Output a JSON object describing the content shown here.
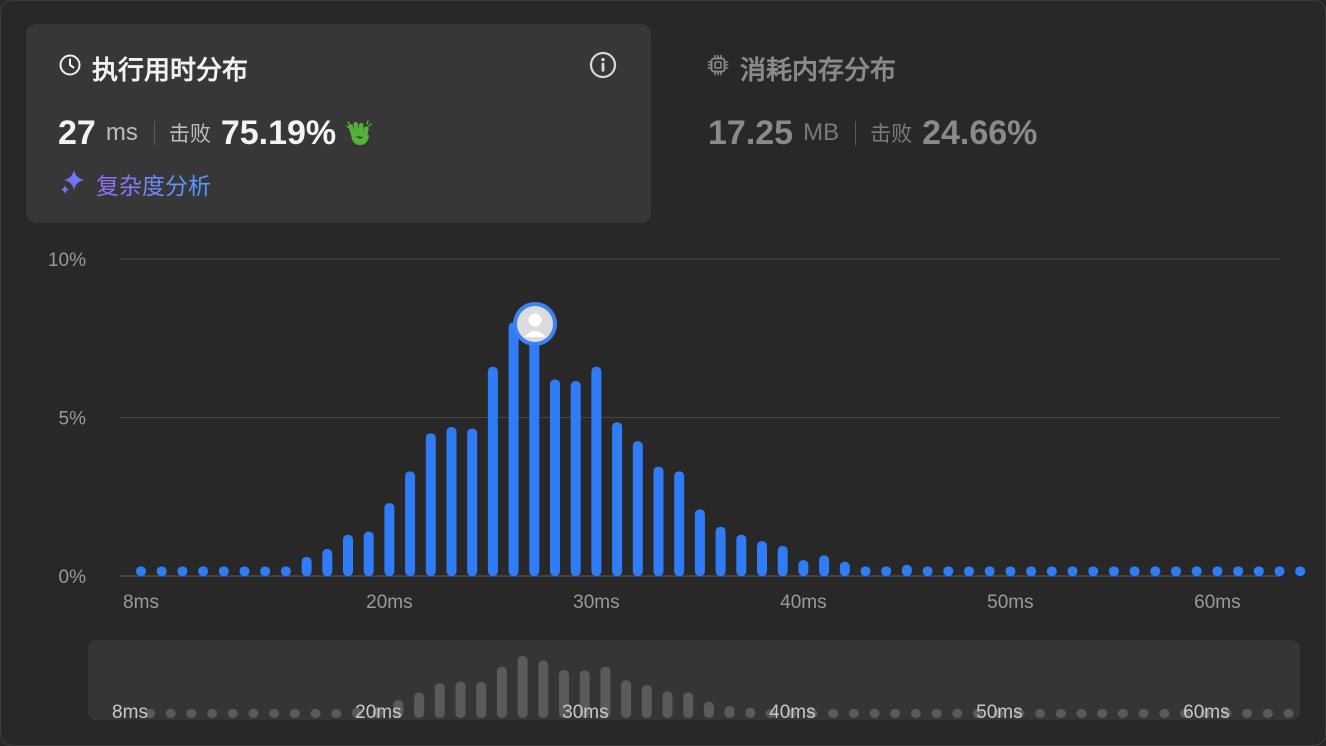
{
  "runtime": {
    "title": "执行用时分布",
    "value": "27",
    "unit": "ms",
    "beat_label": "击败",
    "beat_pct": "75.19%",
    "info_icon": "info-circle-icon",
    "title_icon": "clock-icon",
    "emoji_icon": "clapping-hands-icon"
  },
  "memory": {
    "title": "消耗内存分布",
    "value": "17.25",
    "unit": "MB",
    "beat_label": "击败",
    "beat_pct": "24.66%",
    "title_icon": "cpu-chip-icon"
  },
  "complexity_link": {
    "label": "复杂度分析",
    "icon": "sparkle-icon"
  },
  "colors": {
    "bar": "#2f7cf6",
    "brush_bar": "#5a5a5a",
    "marker_ring": "#3b82f6",
    "accent_start": "#9b6bf5",
    "accent_end": "#4f9cff"
  },
  "chart_data": {
    "type": "bar",
    "title": "",
    "xlabel": "",
    "ylabel": "",
    "ylim": [
      0,
      10
    ],
    "y_ticks": [
      {
        "value": 0,
        "label": "0%"
      },
      {
        "value": 5,
        "label": "5%"
      },
      {
        "value": 10,
        "label": "10%"
      }
    ],
    "x_ticks": [
      {
        "value": 8,
        "label": "8ms"
      },
      {
        "value": 20,
        "label": "20ms"
      },
      {
        "value": 30,
        "label": "30ms"
      },
      {
        "value": 40,
        "label": "40ms"
      },
      {
        "value": 50,
        "label": "50ms"
      },
      {
        "value": 60,
        "label": "60ms"
      }
    ],
    "x": [
      8,
      9,
      10,
      11,
      12,
      13,
      14,
      15,
      16,
      17,
      18,
      19,
      20,
      21,
      22,
      23,
      24,
      25,
      26,
      27,
      28,
      29,
      30,
      31,
      32,
      33,
      34,
      35,
      36,
      37,
      38,
      39,
      40,
      41,
      42,
      43,
      44,
      45,
      46,
      47,
      48,
      49,
      50,
      51,
      52,
      53,
      54,
      55,
      56,
      57,
      58,
      59,
      60,
      61,
      62,
      63,
      64
    ],
    "values": [
      0.3,
      0.3,
      0.3,
      0.3,
      0.3,
      0.3,
      0.3,
      0.3,
      0.6,
      0.85,
      1.3,
      1.4,
      2.3,
      3.3,
      4.5,
      4.7,
      4.65,
      6.6,
      8.0,
      7.4,
      6.2,
      6.15,
      6.6,
      4.85,
      4.25,
      3.45,
      3.3,
      2.1,
      1.55,
      1.3,
      1.1,
      0.95,
      0.5,
      0.65,
      0.45,
      0.3,
      0.3,
      0.35,
      0.3,
      0.3,
      0.3,
      0.3,
      0.3,
      0.3,
      0.3,
      0.3,
      0.3,
      0.3,
      0.3,
      0.3,
      0.3,
      0.3,
      0.3,
      0.3,
      0.3,
      0.3,
      0.3
    ],
    "highlight_x": 28,
    "grid": true,
    "legend": "none",
    "overview": {
      "type": "bar",
      "x_ticks": [
        {
          "value": 8,
          "label": "8ms"
        },
        {
          "value": 20,
          "label": "20ms"
        },
        {
          "value": 30,
          "label": "30ms"
        },
        {
          "value": 40,
          "label": "40ms"
        },
        {
          "value": 50,
          "label": "50ms"
        },
        {
          "value": 60,
          "label": "60ms"
        }
      ]
    }
  }
}
